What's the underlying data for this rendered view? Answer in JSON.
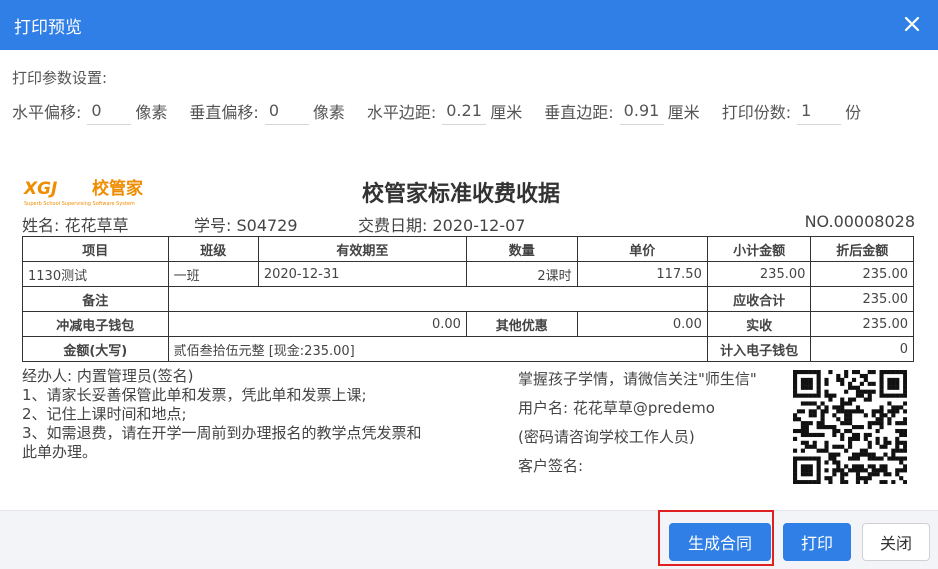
{
  "dialog": {
    "title": "打印预览"
  },
  "params": {
    "section_label": "打印参数设置:",
    "h_offset": {
      "label": "水平偏移:",
      "value": "0",
      "unit": "像素"
    },
    "v_offset": {
      "label": "垂直偏移:",
      "value": "0",
      "unit": "像素"
    },
    "h_margin": {
      "label": "水平边距:",
      "value": "0.21",
      "unit": "厘米"
    },
    "v_margin": {
      "label": "垂直边距:",
      "value": "0.91",
      "unit": "厘米"
    },
    "copies": {
      "label": "打印份数:",
      "value": "1",
      "unit": "份"
    }
  },
  "receipt": {
    "logo_text": "校管家",
    "logo_mark": "XGJ",
    "logo_subtitle": "Superb School Supervising Software System",
    "title": "校管家标准收费收据",
    "name": "姓名: 花花草草",
    "student_no": "学号: S04729",
    "pay_date": "交费日期: 2020-12-07",
    "receipt_no": "NO.00008028",
    "headers": [
      "项目",
      "班级",
      "有效期至",
      "数量",
      "单价",
      "小计金额",
      "折后金额"
    ],
    "row": [
      "1130测试",
      "一班",
      "2020-12-31",
      "2课时",
      "117.50",
      "235.00",
      "235.00"
    ],
    "remark_label": "备注",
    "receivable_label": "应收合计",
    "receivable_value": "235.00",
    "wallet_deduct_label": "冲减电子钱包",
    "wallet_deduct_value": "0.00",
    "other_discount_label": "其他优惠",
    "other_discount_value": "0.00",
    "actual_label": "实收",
    "actual_value": "235.00",
    "amount_words_label": "金额(大写)",
    "amount_words_value": "贰佰叁拾伍元整 [现金:235.00]",
    "wallet_in_label": "计入电子钱包",
    "wallet_in_value": "0",
    "handler": "经办人: 内置管理员(签名)",
    "note1": "1、请家长妥善保管此单和发票，凭此单和发票上课;",
    "note2": "2、记住上课时间和地点;",
    "note3": "3、如需退费，请在开学一周前到办理报名的教学点凭发票和此单办理。",
    "wechat1": "掌握孩子学情，请微信关注\"师生信\"",
    "username": "用户名: 花花草草@predemo",
    "pwd_hint": "(密码请咨询学校工作人员)",
    "client_sign": "客户签名:"
  },
  "buttons": {
    "generate": "生成合同",
    "print": "打印",
    "close": "关闭"
  },
  "colors": {
    "primary": "#2f7fe6",
    "highlight": "#e02020",
    "logo": "#f08c00"
  }
}
